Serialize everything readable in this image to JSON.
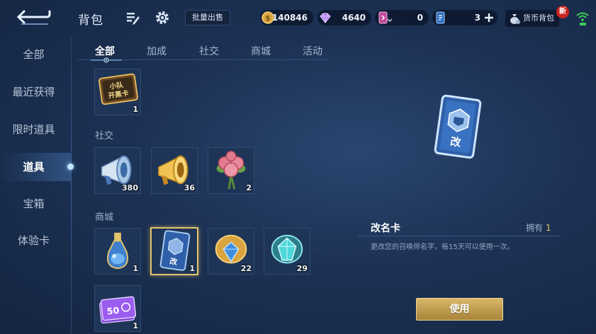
{
  "header": {
    "title": "背包",
    "bulk_sell_label": "批量出售",
    "currencies": [
      {
        "icon": "gold-coin-icon",
        "value": "140846"
      },
      {
        "icon": "diamond-icon",
        "value": "4640"
      },
      {
        "icon": "pink-card-icon",
        "value": "0"
      },
      {
        "icon": "blue-card-icon",
        "value": "3"
      }
    ],
    "wallet_label": "货币背包",
    "new_badge": "新"
  },
  "sidebar": {
    "items": [
      {
        "label": "全部"
      },
      {
        "label": "最近获得"
      },
      {
        "label": "限时道具"
      },
      {
        "label": "道具"
      },
      {
        "label": "宝箱"
      },
      {
        "label": "体验卡"
      }
    ],
    "active_index": 3
  },
  "tabs": {
    "items": [
      {
        "label": "全部"
      },
      {
        "label": "加成"
      },
      {
        "label": "社交"
      },
      {
        "label": "商城"
      },
      {
        "label": "活动"
      }
    ],
    "active_index": 0
  },
  "sections": {
    "social_label": "社交",
    "shop_label": "商城"
  },
  "items": {
    "team_card": {
      "art_text_1": "小队",
      "art_text_2": "开黑卡",
      "count": "1"
    },
    "megaphone_blue": {
      "count": "380"
    },
    "megaphone_gold": {
      "count": "36"
    },
    "roses": {
      "count": "2"
    },
    "potion": {
      "count": "1"
    },
    "rename_card": {
      "art_text": "改",
      "count": "1"
    },
    "gold_gem": {
      "count": "22"
    },
    "teal_gem": {
      "count": "29"
    },
    "ticket50": {
      "art_text": "50",
      "count": "1"
    }
  },
  "detail": {
    "card_text": "改",
    "name": "改名卡",
    "own_label": "拥有",
    "own_count": "1",
    "description": "更改您的召唤师名字，每15天可以使用一次。",
    "use_label": "使用"
  },
  "colors": {
    "accent_gold": "#e3c36a",
    "background": "#1c3154",
    "new_badge": "#c8241d"
  }
}
